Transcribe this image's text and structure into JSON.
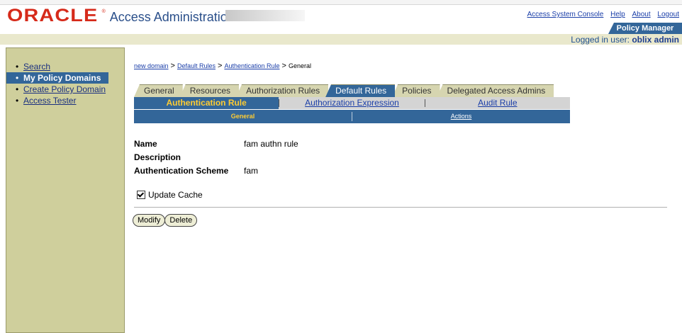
{
  "brand": {
    "logo": "ORACLE",
    "app_title": "Access Administration"
  },
  "global_links": [
    "Access System Console",
    "Help",
    "About",
    "Logout"
  ],
  "policy_manager_tab": "Policy Manager",
  "logged_in": {
    "prefix": "Logged in user:",
    "user": "oblix admin"
  },
  "sidebar": {
    "items": [
      {
        "label": "Search",
        "active": false
      },
      {
        "label": "My Policy Domains",
        "active": true
      },
      {
        "label": "Create Policy Domain",
        "active": false
      },
      {
        "label": "Access Tester",
        "active": false
      }
    ]
  },
  "breadcrumb": [
    "new domain",
    "Default Rules",
    "Authentication Rule",
    "General"
  ],
  "tabs": [
    "General",
    "Resources",
    "Authorization Rules",
    "Default Rules",
    "Policies",
    "Delegated Access Admins"
  ],
  "active_tab": "Default Rules",
  "subtabs": [
    "Authentication Rule",
    "Authorization Expression",
    "Audit Rule"
  ],
  "subsubtabs": [
    "General",
    "Actions"
  ],
  "fields": [
    {
      "label": "Name",
      "value": "fam authn rule"
    },
    {
      "label": "Description",
      "value": ""
    },
    {
      "label": "Authentication Scheme",
      "value": "fam"
    }
  ],
  "update_cache": {
    "label": "Update Cache",
    "checked": true
  },
  "buttons": {
    "modify": "Modify",
    "delete": "Delete"
  }
}
